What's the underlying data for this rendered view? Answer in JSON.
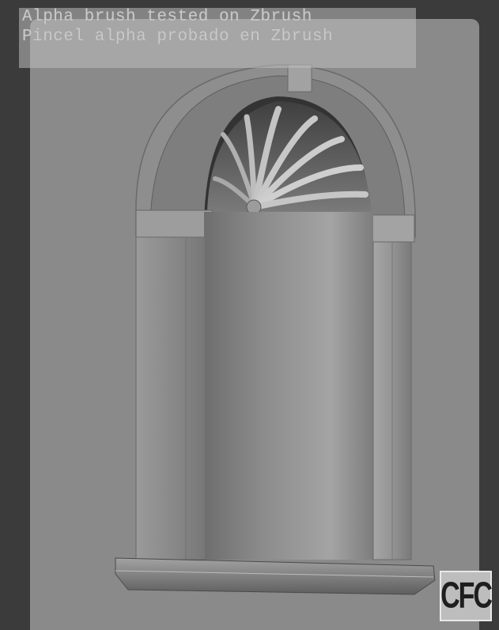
{
  "caption": {
    "line1": "Alpha brush tested on Zbrush",
    "line2": "Pincel alpha probado en Zbrush"
  },
  "logo": {
    "text": "CFC"
  },
  "colors": {
    "background": "#3b3b3b",
    "sculpt": "#8a8a8a"
  }
}
